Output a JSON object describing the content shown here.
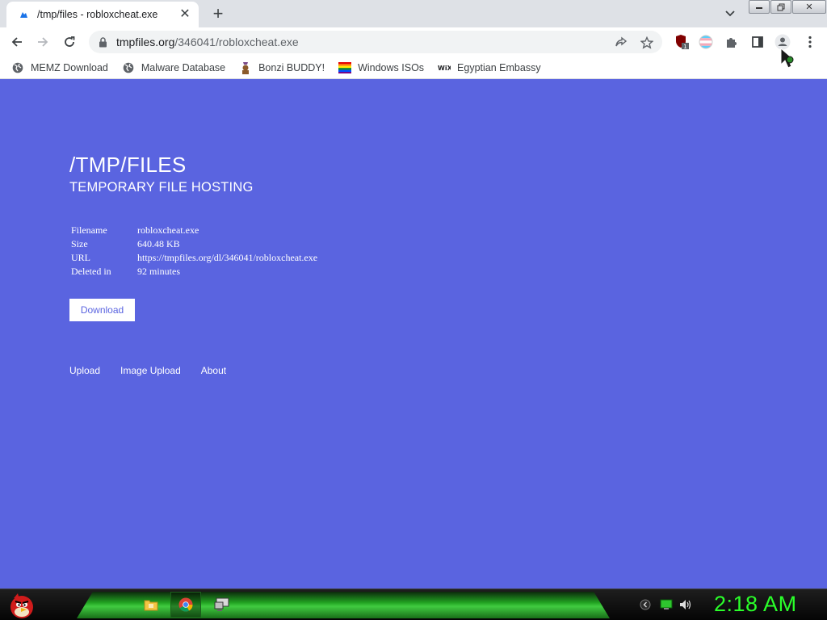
{
  "browser": {
    "tab": {
      "title": "/tmp/files - robloxcheat.exe"
    },
    "address": {
      "host": "tmpfiles.org",
      "path": "/346041/robloxcheat.exe"
    },
    "extension_badge": "1",
    "bookmarks": [
      {
        "label": "MEMZ Download",
        "icon": "globe-icon"
      },
      {
        "label": "Malware Database",
        "icon": "globe-icon"
      },
      {
        "label": "Bonzi BUDDY!",
        "icon": "bonzi-icon"
      },
      {
        "label": "Windows ISOs",
        "icon": "rainbow-flag-icon"
      },
      {
        "label": "Egyptian Embassy",
        "icon": "wix-icon"
      }
    ]
  },
  "page": {
    "title": "/TMP/FILES",
    "subtitle": "TEMPORARY FILE HOSTING",
    "info": [
      {
        "key": "Filename",
        "value": "robloxcheat.exe"
      },
      {
        "key": "Size",
        "value": "640.48 KB"
      },
      {
        "key": "URL",
        "value": "https://tmpfiles.org/dl/346041/robloxcheat.exe"
      },
      {
        "key": "Deleted in",
        "value": "92 minutes"
      }
    ],
    "download_label": "Download",
    "footer_links": [
      "Upload",
      "Image Upload",
      "About"
    ],
    "background_color": "#5a64e0"
  },
  "taskbar": {
    "clock": "2:18 AM",
    "apps": [
      "file-explorer-icon",
      "chrome-icon",
      "remote-desktop-icon"
    ]
  }
}
